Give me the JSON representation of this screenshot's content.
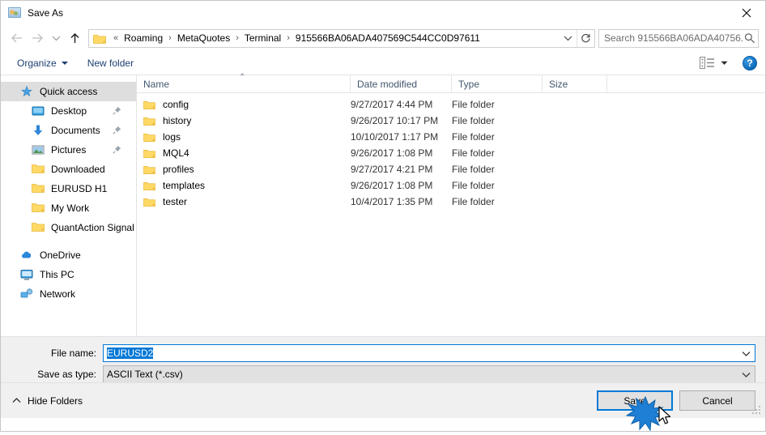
{
  "window": {
    "title": "Save As",
    "title_icon": "image-user-icon",
    "close_label": "✕"
  },
  "nav": {
    "back_icon": "arrow-left-icon",
    "forward_icon": "arrow-right-icon",
    "recent_icon": "chevron-down-icon",
    "up_icon": "arrow-up-icon",
    "refresh_icon": "refresh-icon",
    "dropdown_icon": "chevron-down-icon",
    "address_prefix": "«",
    "breadcrumbs": [
      "Roaming",
      "MetaQuotes",
      "Terminal",
      "915566BA06ADA407569C544CC0D97611"
    ],
    "separator": "›"
  },
  "search": {
    "placeholder": "Search 915566BA06ADA40756...",
    "icon": "search-icon"
  },
  "toolbar": {
    "organize_label": "Organize",
    "new_folder_label": "New folder",
    "view_icon": "view-list-icon",
    "view_caret_icon": "chevron-down-icon",
    "help_label": "?",
    "help_icon": "help-icon"
  },
  "sidebar": {
    "items": [
      {
        "label": "Quick access",
        "icon": "star-pin-icon",
        "selected": true,
        "indent": false,
        "pinned": false
      },
      {
        "label": "Desktop",
        "icon": "desktop-icon",
        "selected": false,
        "indent": true,
        "pinned": true
      },
      {
        "label": "Documents",
        "icon": "documents-icon",
        "selected": false,
        "indent": true,
        "pinned": true
      },
      {
        "label": "Pictures",
        "icon": "pictures-icon",
        "selected": false,
        "indent": true,
        "pinned": true
      },
      {
        "label": "Downloaded",
        "icon": "folder-icon",
        "selected": false,
        "indent": true,
        "pinned": false
      },
      {
        "label": "EURUSD H1",
        "icon": "folder-icon",
        "selected": false,
        "indent": true,
        "pinned": false
      },
      {
        "label": "My Work",
        "icon": "folder-icon",
        "selected": false,
        "indent": true,
        "pinned": false
      },
      {
        "label": "QuantAction Signal",
        "icon": "folder-icon",
        "selected": false,
        "indent": true,
        "pinned": false
      },
      {
        "label": "OneDrive",
        "icon": "onedrive-icon",
        "selected": false,
        "indent": false,
        "pinned": false
      },
      {
        "label": "This PC",
        "icon": "this-pc-icon",
        "selected": false,
        "indent": false,
        "pinned": false
      },
      {
        "label": "Network",
        "icon": "network-icon",
        "selected": false,
        "indent": false,
        "pinned": false
      }
    ]
  },
  "filelist": {
    "columns": [
      "Name",
      "Date modified",
      "Type",
      "Size"
    ],
    "sort_column": "Name",
    "sort_caret": "⌃",
    "rows": [
      {
        "name": "config",
        "date": "9/27/2017 4:44 PM",
        "type": "File folder",
        "size": ""
      },
      {
        "name": "history",
        "date": "9/26/2017 10:17 PM",
        "type": "File folder",
        "size": ""
      },
      {
        "name": "logs",
        "date": "10/10/2017 1:17 PM",
        "type": "File folder",
        "size": ""
      },
      {
        "name": "MQL4",
        "date": "9/26/2017 1:08 PM",
        "type": "File folder",
        "size": ""
      },
      {
        "name": "profiles",
        "date": "9/27/2017 4:21 PM",
        "type": "File folder",
        "size": ""
      },
      {
        "name": "templates",
        "date": "9/26/2017 1:08 PM",
        "type": "File folder",
        "size": ""
      },
      {
        "name": "tester",
        "date": "10/4/2017 1:35 PM",
        "type": "File folder",
        "size": ""
      }
    ]
  },
  "form": {
    "filename_label": "File name:",
    "filename_value": "EURUSD2",
    "savetype_label": "Save as type:",
    "savetype_value": "ASCII Text (*.csv)",
    "chevron_icon": "chevron-down-icon"
  },
  "footer": {
    "hide_folders_label": "Hide Folders",
    "hide_folders_icon": "chevron-up-icon",
    "save_label": "Save",
    "cancel_label": "Cancel",
    "resize_grip_icon": "resize-grip-icon",
    "click_effect_icon": "click-burst-icon",
    "cursor_icon": "mouse-pointer-icon"
  },
  "colors": {
    "accent": "#0078d7",
    "folder_yellow": "#ffd966",
    "header_text": "#42566e",
    "toolbar_text": "#1b3f72",
    "chrome_bg": "#f0f0f0"
  }
}
